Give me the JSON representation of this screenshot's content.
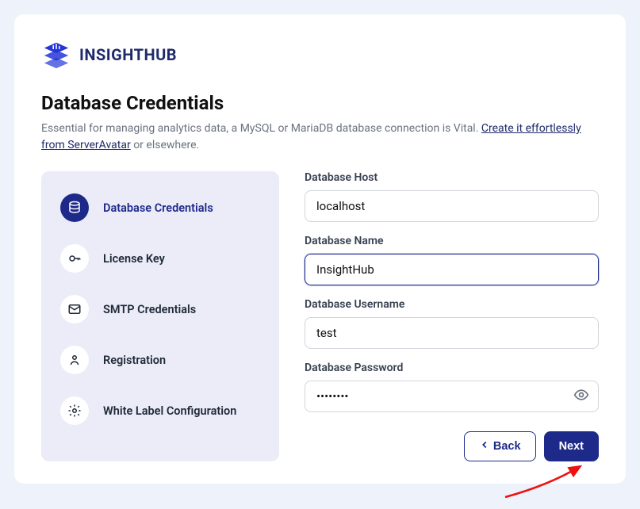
{
  "brand": {
    "name": "INSIGHTHUB"
  },
  "header": {
    "title": "Database Credentials",
    "desc_pre": "Essential for managing analytics data, a MySQL or MariaDB database connection is Vital. ",
    "link": "Create it effortlessly from ServerAvatar",
    "desc_post": " or elsewhere."
  },
  "steps": [
    {
      "label": "Database Credentials"
    },
    {
      "label": "License Key"
    },
    {
      "label": "SMTP Credentials"
    },
    {
      "label": "Registration"
    },
    {
      "label": "White Label Configuration"
    }
  ],
  "form": {
    "host": {
      "label": "Database Host",
      "value": "localhost"
    },
    "name": {
      "label": "Database Name",
      "value": "InsightHub"
    },
    "user": {
      "label": "Database Username",
      "value": "test"
    },
    "pass": {
      "label": "Database Password",
      "value": "••••••••"
    }
  },
  "actions": {
    "back": "Back",
    "next": "Next"
  }
}
